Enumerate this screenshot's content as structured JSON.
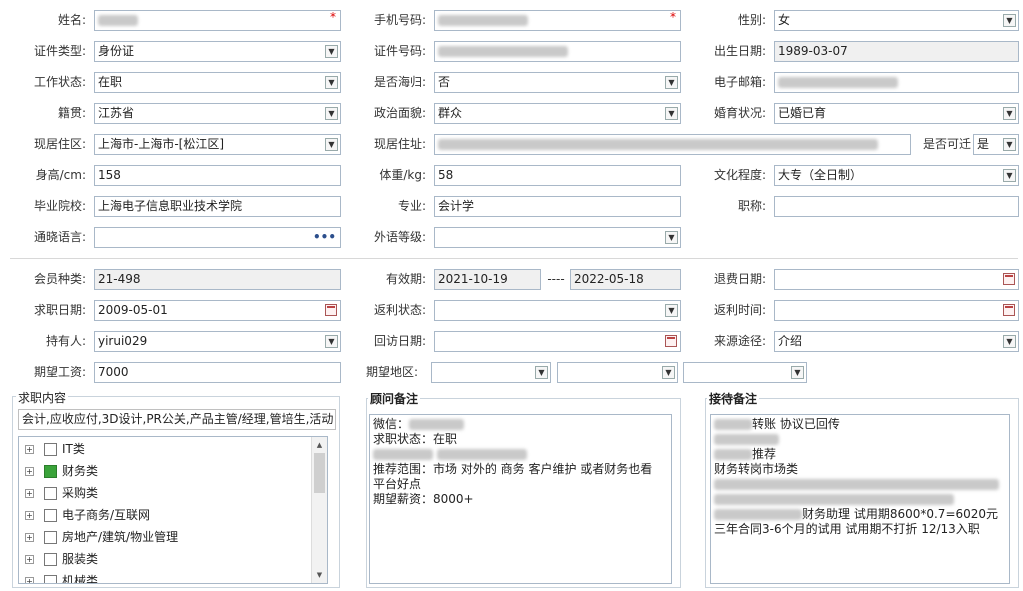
{
  "row1": {
    "name_label": "姓名:",
    "phone_label": "手机号码:",
    "gender_label": "性别:",
    "gender": "女",
    "required_mark": "*"
  },
  "row2": {
    "id_type_label": "证件类型:",
    "id_type": "身份证",
    "id_no_label": "证件号码:",
    "birth_label": "出生日期:",
    "birth": "1989-03-07"
  },
  "row3": {
    "work_label": "工作状态:",
    "work": "在职",
    "overseas_label": "是否海归:",
    "overseas": "否",
    "email_label": "电子邮箱:"
  },
  "row4": {
    "native_label": "籍贯:",
    "native": "江苏省",
    "political_label": "政治面貌:",
    "political": "群众",
    "marital_label": "婚育状况:",
    "marital": "已婚已育"
  },
  "row5": {
    "area_label": "现居住区:",
    "area": "上海市-上海市-[松江区]",
    "addr_label": "现居住址:",
    "move_label": "是否可迁",
    "move": "是"
  },
  "row6": {
    "height_label": "身高/cm:",
    "height": "158",
    "weight_label": "体重/kg:",
    "weight": "58",
    "edu_label": "文化程度:",
    "edu": "大专（全日制）"
  },
  "row7": {
    "school_label": "毕业院校:",
    "school": "上海电子信息职业技术学院",
    "major_label": "专业:",
    "major": "会计学",
    "title_label": "职称:"
  },
  "row8": {
    "lang_label": "通晓语言:",
    "lang_btn": "•••",
    "foreign_label": "外语等级:"
  },
  "row9": {
    "member_label": "会员种类:",
    "member": "21-498",
    "valid_label": "有效期:",
    "valid_from": "2021-10-19",
    "valid_dash": "----",
    "valid_to": "2022-05-18",
    "refund_label": "退费日期:"
  },
  "row10": {
    "apply_label": "求职日期:",
    "apply": "2009-05-01",
    "rebate_status_label": "返利状态:",
    "rebate_time_label": "返利时间:"
  },
  "row11": {
    "holder_label": "持有人:",
    "holder": "yirui029",
    "revisit_label": "回访日期:",
    "source_label": "来源途径:",
    "source": "介绍"
  },
  "row12": {
    "salary_label": "期望工资:",
    "salary": "7000",
    "region_label": "期望地区:"
  },
  "job": {
    "title": "求职内容",
    "summary": "会计,应收应付,3D设计,PR公关,产品主管/经理,管培生,活动",
    "items": [
      {
        "label": "IT类",
        "checked": false
      },
      {
        "label": "财务类",
        "checked": true
      },
      {
        "label": "采购类",
        "checked": false
      },
      {
        "label": "电子商务/互联网",
        "checked": false
      },
      {
        "label": "房地产/建筑/物业管理",
        "checked": false
      },
      {
        "label": "服装类",
        "checked": false
      },
      {
        "label": "机械类",
        "checked": false
      }
    ]
  },
  "advisor": {
    "title": "顾问备注",
    "l1": "微信：",
    "l2": "求职状态：在职",
    "l4": "推荐范围：市场 对外的 商务   客户维护 或者财务也看",
    "l5": "平台好点",
    "l6": "期望薪资：8000+"
  },
  "reception": {
    "title": "接待备注",
    "l1": "转账 协议已回传",
    "l3": "推荐",
    "l4": "财务转岗市场类",
    "l7": "财务助理  试用期8600*0.7=6020元",
    "l8": "三年合同3-6个月的试用 试用期不打折  12/13入职"
  }
}
